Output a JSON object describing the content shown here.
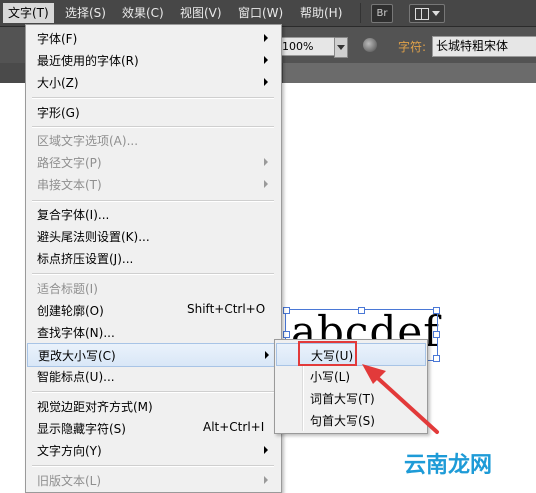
{
  "menubar": {
    "items": [
      "文字(T)",
      "选择(S)",
      "效果(C)",
      "视图(V)",
      "窗口(W)",
      "帮助(H)"
    ],
    "bridge_label": "Br"
  },
  "controlbar": {
    "opacity_value": "100%",
    "char_label": "字符:",
    "font_value": "长城特粗宋体"
  },
  "artboard": {
    "text": "abcdef"
  },
  "type_menu": {
    "items": [
      {
        "label": "字体(F)",
        "shortcut": "",
        "submenu": true,
        "enabled": true
      },
      {
        "label": "最近使用的字体(R)",
        "shortcut": "",
        "submenu": true,
        "enabled": true
      },
      {
        "label": "大小(Z)",
        "shortcut": "",
        "submenu": true,
        "enabled": true
      },
      {
        "label": "字形(G)",
        "shortcut": "",
        "submenu": false,
        "enabled": true
      },
      {
        "label": "区域文字选项(A)...",
        "shortcut": "",
        "submenu": false,
        "enabled": false
      },
      {
        "label": "路径文字(P)",
        "shortcut": "",
        "submenu": true,
        "enabled": false
      },
      {
        "label": "串接文本(T)",
        "shortcut": "",
        "submenu": true,
        "enabled": false
      },
      {
        "label": "复合字体(I)...",
        "shortcut": "",
        "submenu": false,
        "enabled": true
      },
      {
        "label": "避头尾法则设置(K)...",
        "shortcut": "",
        "submenu": false,
        "enabled": true
      },
      {
        "label": "标点挤压设置(J)...",
        "shortcut": "",
        "submenu": false,
        "enabled": true
      },
      {
        "label": "适合标题(I)",
        "shortcut": "",
        "submenu": false,
        "enabled": false
      },
      {
        "label": "创建轮廓(O)",
        "shortcut": "Shift+Ctrl+O",
        "submenu": false,
        "enabled": true
      },
      {
        "label": "查找字体(N)...",
        "shortcut": "",
        "submenu": false,
        "enabled": true
      },
      {
        "label": "更改大小写(C)",
        "shortcut": "",
        "submenu": true,
        "enabled": true
      },
      {
        "label": "智能标点(U)...",
        "shortcut": "",
        "submenu": false,
        "enabled": true
      },
      {
        "label": "视觉边距对齐方式(M)",
        "shortcut": "",
        "submenu": false,
        "enabled": true
      },
      {
        "label": "显示隐藏字符(S)",
        "shortcut": "Alt+Ctrl+I",
        "submenu": false,
        "enabled": true
      },
      {
        "label": "文字方向(Y)",
        "shortcut": "",
        "submenu": true,
        "enabled": true
      },
      {
        "label": "旧版文本(L)",
        "shortcut": "",
        "submenu": true,
        "enabled": false
      }
    ]
  },
  "case_submenu": {
    "items": [
      "大写(U)",
      "小写(L)",
      "词首大写(T)",
      "句首大写(S)"
    ]
  },
  "watermark": "云南龙网",
  "colors": {
    "highlight_border": "#e23a3a",
    "menubar_bg": "#474747",
    "watermark": "#1e9bd7"
  }
}
